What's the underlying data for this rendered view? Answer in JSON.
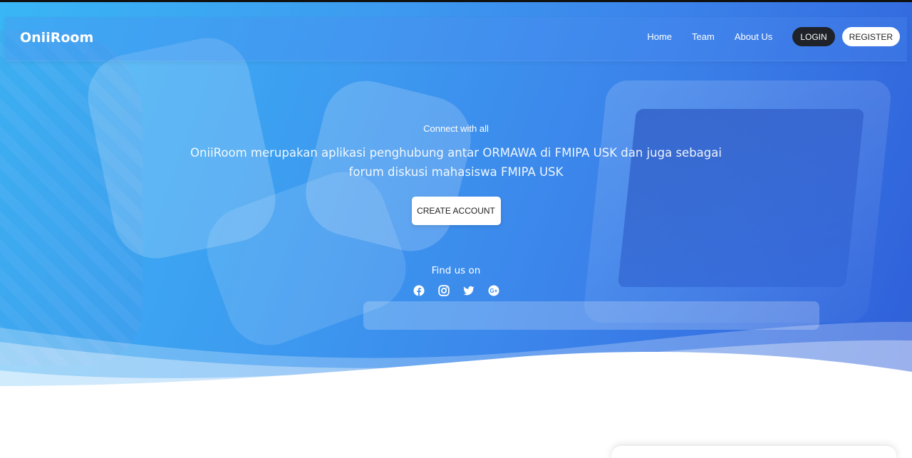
{
  "brand": {
    "name": "OniiRoom"
  },
  "nav": {
    "links": [
      "Home",
      "Team",
      "About Us"
    ],
    "login_label": "LOGIN",
    "register_label": "REGISTER"
  },
  "hero": {
    "eyebrow": "Connect with all",
    "lead": "OniiRoom merupakan aplikasi penghubung antar ORMAWA di FMIPA USK dan juga sebagai forum diskusi mahasiswa FMIPA USK",
    "cta_label": "CREATE ACCOUNT",
    "find_us": "Find us on",
    "socials": [
      "facebook-icon",
      "instagram-icon",
      "twitter-icon",
      "google-plus-icon"
    ]
  },
  "colors": {
    "gradient_start": "#39b6f5",
    "gradient_end": "#2f5fd9",
    "login_bg": "#1f2229",
    "register_bg": "#ffffff"
  }
}
